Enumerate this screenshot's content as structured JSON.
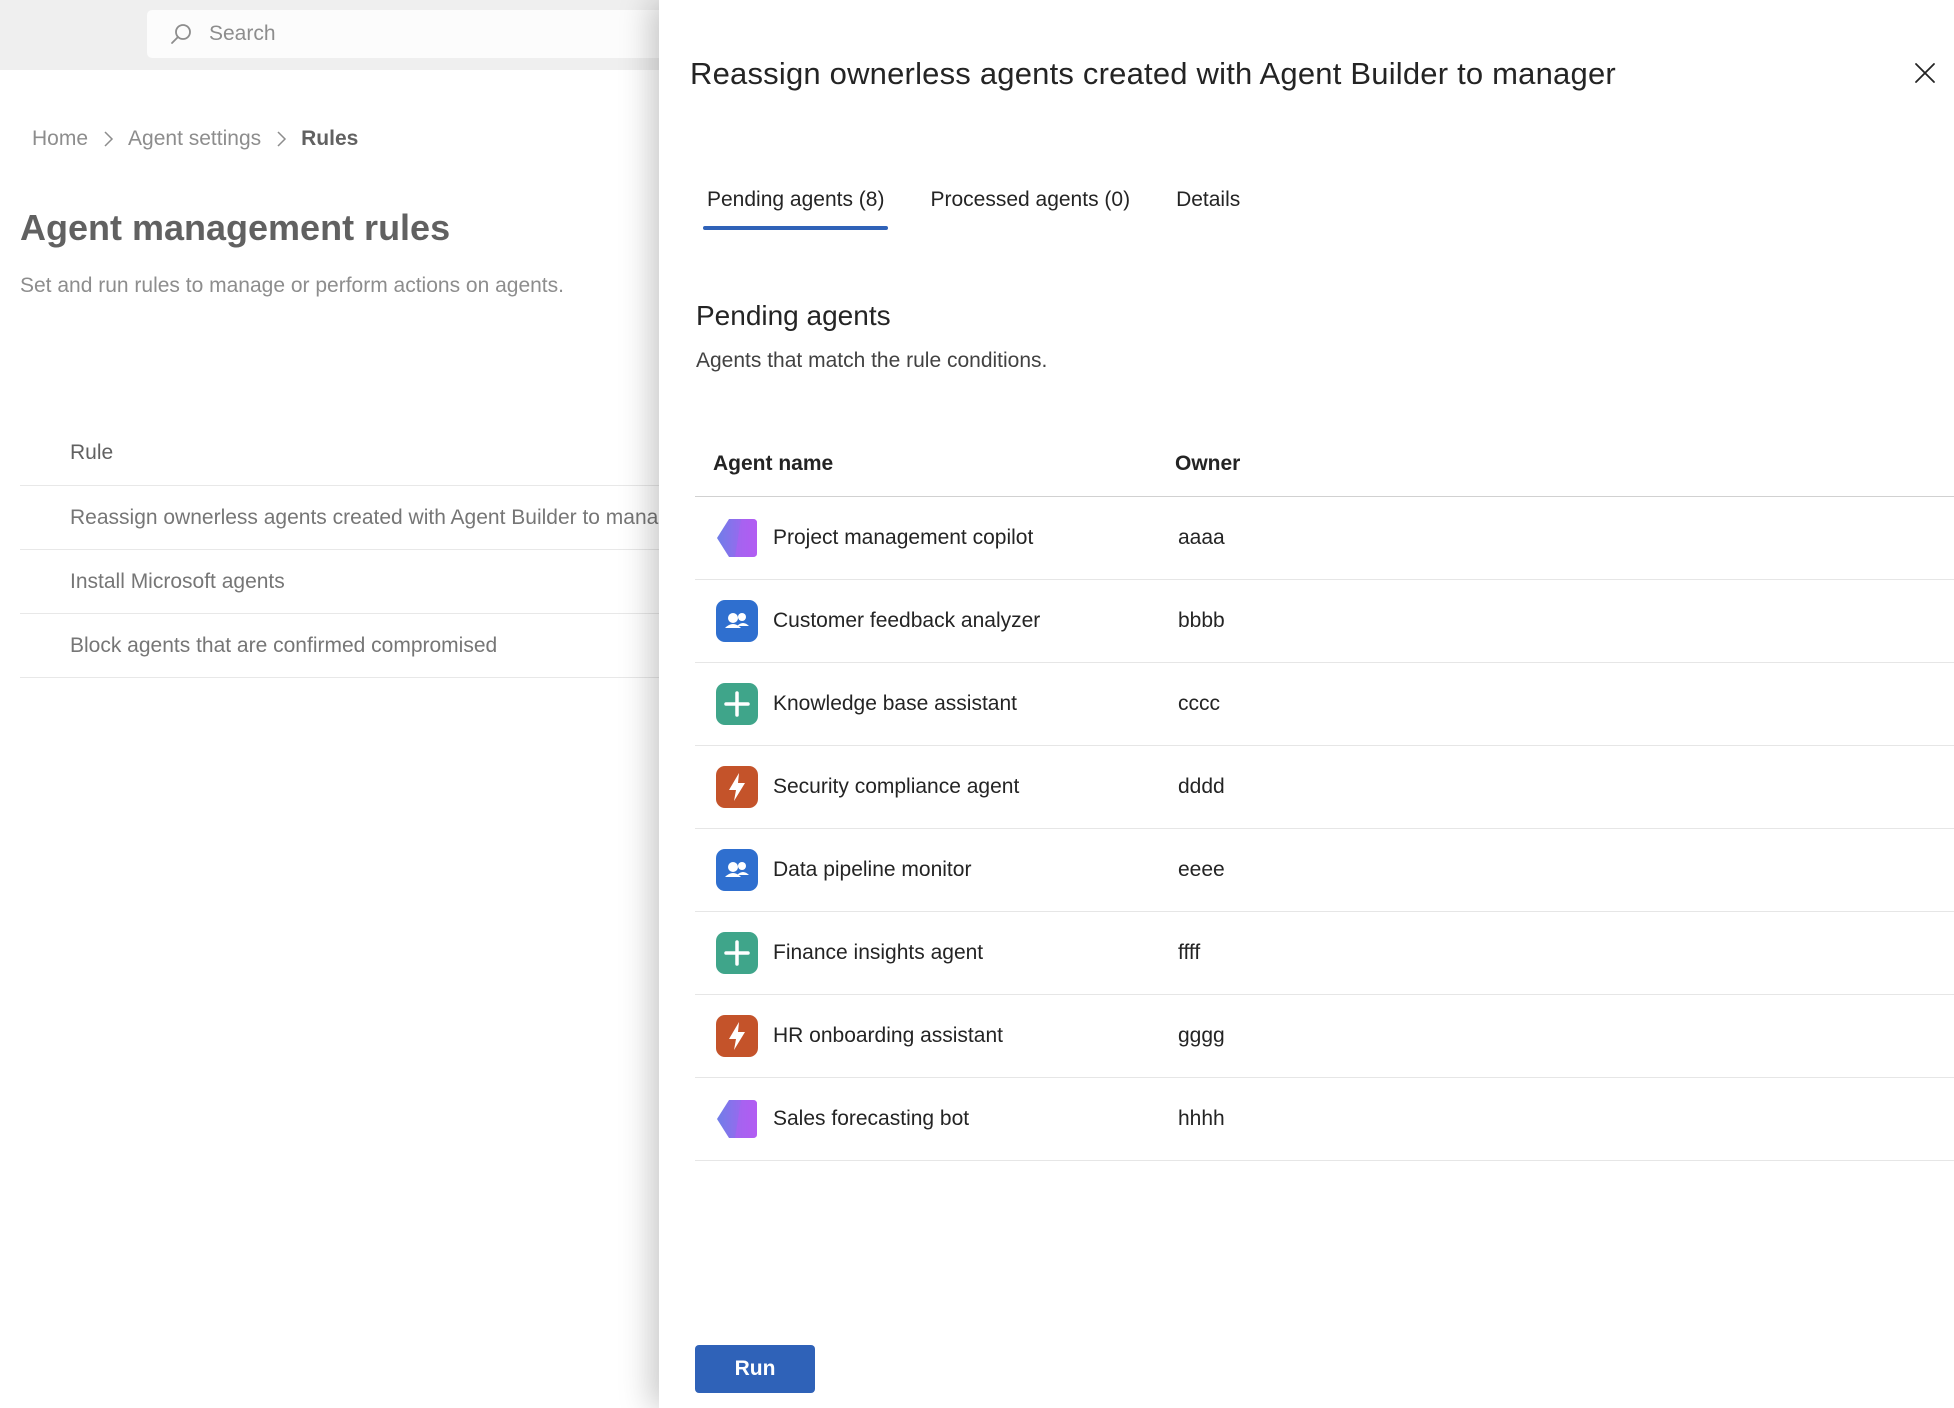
{
  "background": {
    "search": {
      "placeholder": "Search",
      "icon": "search-icon"
    },
    "breadcrumb": [
      {
        "label": "Home"
      },
      {
        "label": "Agent settings"
      },
      {
        "label": "Rules"
      }
    ],
    "page_title": "Agent management rules",
    "page_subtitle": "Set and run rules to manage or perform actions on agents.",
    "rules_column_header": "Rule",
    "rules": [
      "Reassign ownerless agents created with Agent Builder to manager",
      "Install Microsoft agents",
      "Block agents that are confirmed compromised"
    ]
  },
  "panel": {
    "title": "Reassign ownerless agents created with Agent Builder to manager",
    "close_icon": "close-icon",
    "tabs": [
      {
        "label": "Pending agents (8)",
        "active": true
      },
      {
        "label": "Processed agents (0)",
        "active": false
      },
      {
        "label": "Details",
        "active": false
      }
    ],
    "section_title": "Pending agents",
    "section_subtitle": "Agents that match the rule conditions.",
    "table": {
      "headers": {
        "name": "Agent name",
        "owner": "Owner"
      },
      "rows": [
        {
          "name": "Project management copilot",
          "owner": "aaaa",
          "icon": "hexagon-agent-icon"
        },
        {
          "name": "Customer feedback analyzer",
          "owner": "bbbb",
          "icon": "people-agent-icon"
        },
        {
          "name": "Knowledge base assistant",
          "owner": "cccc",
          "icon": "plus-agent-icon"
        },
        {
          "name": "Security compliance agent",
          "owner": "dddd",
          "icon": "lightning-agent-icon"
        },
        {
          "name": "Data pipeline monitor",
          "owner": "eeee",
          "icon": "people-agent-icon"
        },
        {
          "name": "Finance insights agent",
          "owner": "ffff",
          "icon": "plus-agent-icon"
        },
        {
          "name": "HR onboarding assistant",
          "owner": "gggg",
          "icon": "lightning-agent-icon"
        },
        {
          "name": "Sales forecasting bot",
          "owner": "hhhh",
          "icon": "hexagon-agent-icon"
        }
      ]
    },
    "run_label": "Run",
    "colors": {
      "accent": "#2f62b8",
      "people_icon": "#2f6fcf",
      "plus_icon": "#3fa58a",
      "lightning_icon": "#c4532a",
      "hexagon_icon_from": "#6f7ee8",
      "hexagon_icon_to": "#b35cf2"
    }
  }
}
